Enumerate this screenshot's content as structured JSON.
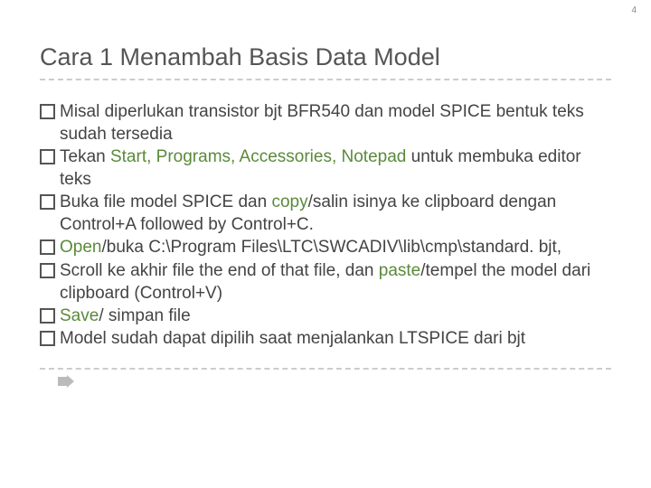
{
  "page_number": "4",
  "title": "Cara 1 Menambah Basis Data Model",
  "bullets": {
    "b0": {
      "t0": "Misal diperlukan transistor bjt BFR540 dan model SPICE bentuk teks sudah tersedia"
    },
    "b1": {
      "t0": "Tekan ",
      "a0": "Start, Programs, Accessories, Notepad",
      "t1": " untuk membuka editor teks"
    },
    "b2": {
      "t0": "Buka file model SPICE dan ",
      "a0": "copy",
      "t1": "/salin isinya ke clipboard dengan Control+A followed by Control+C."
    },
    "b3": {
      "a0": "Open",
      "t0": "/buka C:\\Program Files\\LTC\\SWCADIV\\lib\\cmp\\standard. bjt,"
    },
    "b4": {
      "t0": "Scroll ke akhir file the end of that file, dan ",
      "a0": "paste",
      "t1": "/tempel the model dari clipboard (Control+V)"
    },
    "b5": {
      "a0": "Save",
      "t0": "/ simpan file"
    },
    "b6": {
      "t0": "Model sudah dapat dipilih saat menjalankan LTSPICE dari bjt"
    }
  }
}
